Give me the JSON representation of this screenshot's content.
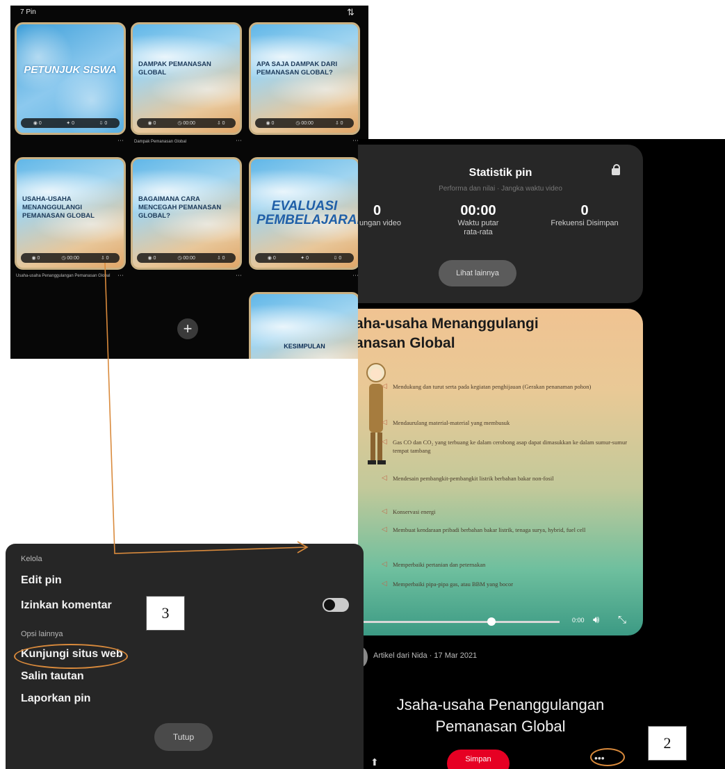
{
  "board": {
    "count_label": "7 Pin",
    "pins": [
      {
        "title": "PETUNJUK Siswa",
        "caption": ""
      },
      {
        "title": "DAMPAK PEMANASAN GLOBAL",
        "caption": "Dampak Pemanasan Global"
      },
      {
        "title": "APA SAJA DAMPAK DARI PEMANASAN GLOBAL?",
        "caption": ""
      },
      {
        "title": "USAHA-USAHA MENANGGULANGI PEMANASAN GLOBAL",
        "caption": "Usaha-usaha Penanggulangan Pemanasan Global"
      },
      {
        "title": "BAGAIMANA CARA MENCEGAH PEMANASAN GLOBAL?",
        "caption": ""
      },
      {
        "title": "EVALUASI PEMBELAJARAN",
        "caption": ""
      },
      {
        "title": "KESIMPULAN",
        "caption": ""
      }
    ]
  },
  "stats": {
    "title": "Statistik pin",
    "subtitle": "Performa dan nilai · Jangka waktu video",
    "items": [
      {
        "value": "0",
        "label": "ungan video"
      },
      {
        "value": "00:00",
        "label": "Waktu putar rata-rata"
      },
      {
        "value": "0",
        "label": "Frekuensi Disimpan"
      }
    ],
    "view_button": "Lihat lainnya"
  },
  "slide": {
    "title_line1": "aha-usaha Menanggulangi",
    "title_line2": "anasan Global",
    "bullets": [
      "Mendukung dan turut serta pada kegiatan penghijauan (Gerakan penanaman pohon)",
      "Mendaurulang material-material yang membusuk",
      "Gas CO dan CO₂ yang terbuang ke dalam cerobong asap dapat dimasukkan ke dalam sumur-sumur tempat tambang",
      "Mendesain pembangkit-pembangkit listrik berbahan bakar non-fosil",
      "Konservasi energi",
      "Membuat kendaraan pribadi berbahan bakar listrik, tenaga surya, hybrid, fuel cell",
      "Memperbaiki pertanian dan peternakan",
      "Memperbaiki pipa-pipa gas, atau BBM yang bocor"
    ],
    "video_time": "0:00"
  },
  "pin_meta": {
    "author_line": "Artikel dari Nida · 17 Mar 2021",
    "heading_line1": "Jsaha-usaha Penanggulangan",
    "heading_line2": "Pemanasan Global",
    "save_label": "Simpan"
  },
  "options": {
    "section1_header": "Kelola",
    "edit_pin": "Edit pin",
    "allow_comments": "Izinkan komentar",
    "section2_header": "Opsi lainnya",
    "visit_site": "Kunjungi situs web",
    "copy_link": "Salin tautan",
    "report_pin": "Laporkan pin",
    "close_label": "Tutup"
  },
  "steps": {
    "step2": "2",
    "step3": "3"
  },
  "colors": {
    "annotation": "#d98a3c",
    "save": "#e60023"
  }
}
